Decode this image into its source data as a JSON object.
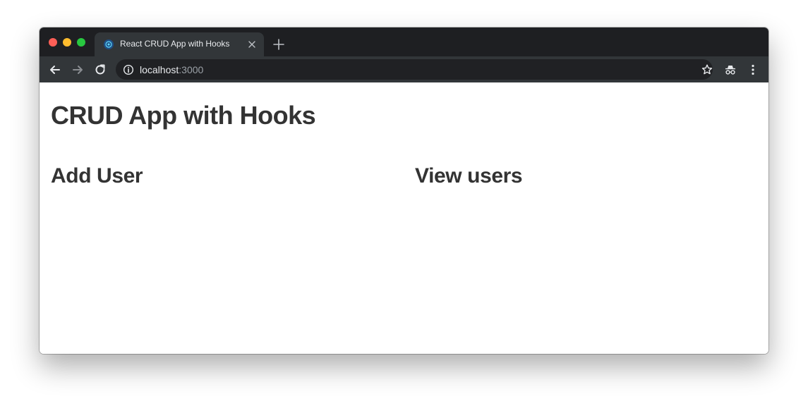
{
  "browser": {
    "tab": {
      "title": "React CRUD App with Hooks",
      "favicon": "react-favicon"
    },
    "address_bar": {
      "host": "localhost",
      "port": ":3000"
    },
    "icons": [
      "back-arrow-icon",
      "forward-arrow-icon",
      "reload-icon",
      "info-icon",
      "star-icon",
      "incognito-icon",
      "kebab-menu-icon",
      "close-icon",
      "plus-icon"
    ],
    "colors": {
      "tabstrip": "#1e1f22",
      "toolbar": "#323639",
      "omnibox": "#202124"
    }
  },
  "page": {
    "title": "CRUD App with Hooks",
    "left_heading": "Add User",
    "right_heading": "View users"
  }
}
